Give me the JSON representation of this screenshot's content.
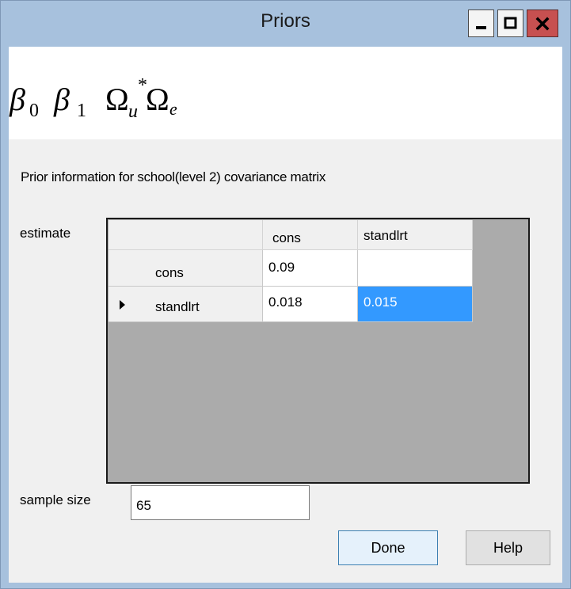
{
  "window": {
    "title": "Priors",
    "controls": {
      "minimize_icon": "minimize-icon",
      "maximize_icon": "maximize-icon",
      "close_icon": "close-icon",
      "close_color": "#c75050"
    }
  },
  "formula": {
    "beta0": "β",
    "beta0_sub": "0",
    "beta1": "β",
    "beta1_sub": "1",
    "omega_u": "Ω",
    "omega_u_sub": "u",
    "omega_u_sup": "*",
    "omega_e": "Ω",
    "omega_e_sub": "e"
  },
  "prior_label": "Prior information for school(level 2) covariance matrix",
  "estimate_label": "estimate",
  "grid": {
    "columns": [
      "cons",
      "standlrt"
    ],
    "rows": [
      {
        "label": "cons",
        "values": [
          "0.09",
          ""
        ]
      },
      {
        "label": "standlrt",
        "values": [
          "0.018",
          "0.015"
        ],
        "current": true
      }
    ],
    "current_row_icon": "row-pointer-icon",
    "selected_color": "#3399ff"
  },
  "sample_size": {
    "label": "sample size",
    "value": "65"
  },
  "buttons": {
    "done": "Done",
    "help": "Help"
  }
}
